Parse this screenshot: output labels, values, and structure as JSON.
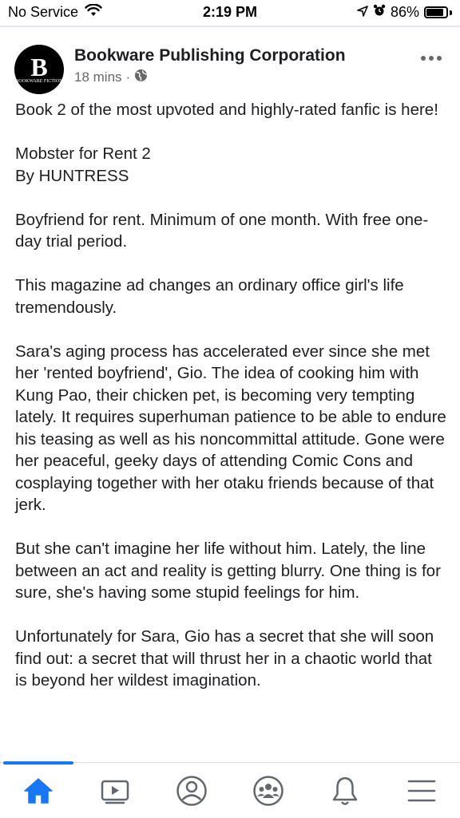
{
  "status_bar": {
    "carrier": "No Service",
    "time": "2:19 PM",
    "battery": "86%",
    "battery_level": 0.86,
    "icons": [
      "wifi-icon",
      "location-arrow-icon",
      "alarm-icon",
      "battery-icon"
    ]
  },
  "post": {
    "page_name": "Bookware Publishing Corporation",
    "avatar_letter": "B",
    "avatar_text": "BOOKWARE FICTION",
    "time_ago": "18 mins",
    "separator": "·",
    "paragraphs": [
      "Book 2 of the most upvoted and highly-rated fanfic is here!",
      "Mobster for Rent 2",
      "By HUNTRESS",
      "Boyfriend for rent. Minimum of one month. With free one-day trial period.",
      "This magazine ad changes an ordinary office girl's life tremendously.",
      "Sara's aging process has accelerated ever since she met her 'rented boyfriend', Gio. The idea of cooking him with Kung Pao, their chicken pet, is becoming very tempting lately. It requires superhuman patience to be able to endure his teasing as well as his noncommittal attitude. Gone were her peaceful, geeky days of attending Comic Cons and cosplaying together with her otaku friends because of that jerk.",
      "But she can't imagine her life without him. Lately, the line between an act and reality is getting blurry. One thing is for sure, she's having some stupid feelings for him.",
      "Unfortunately for Sara, Gio has a secret that she will soon find out: a secret that will thrust her in a chaotic world that is beyond her wildest imagination."
    ]
  },
  "bottom_nav": {
    "items": [
      "home-icon",
      "video-icon",
      "profile-icon",
      "groups-icon",
      "notifications-icon",
      "menu-icon"
    ],
    "active": "home-icon",
    "accent_color": "#1877f2",
    "inactive_color": "#606770"
  }
}
